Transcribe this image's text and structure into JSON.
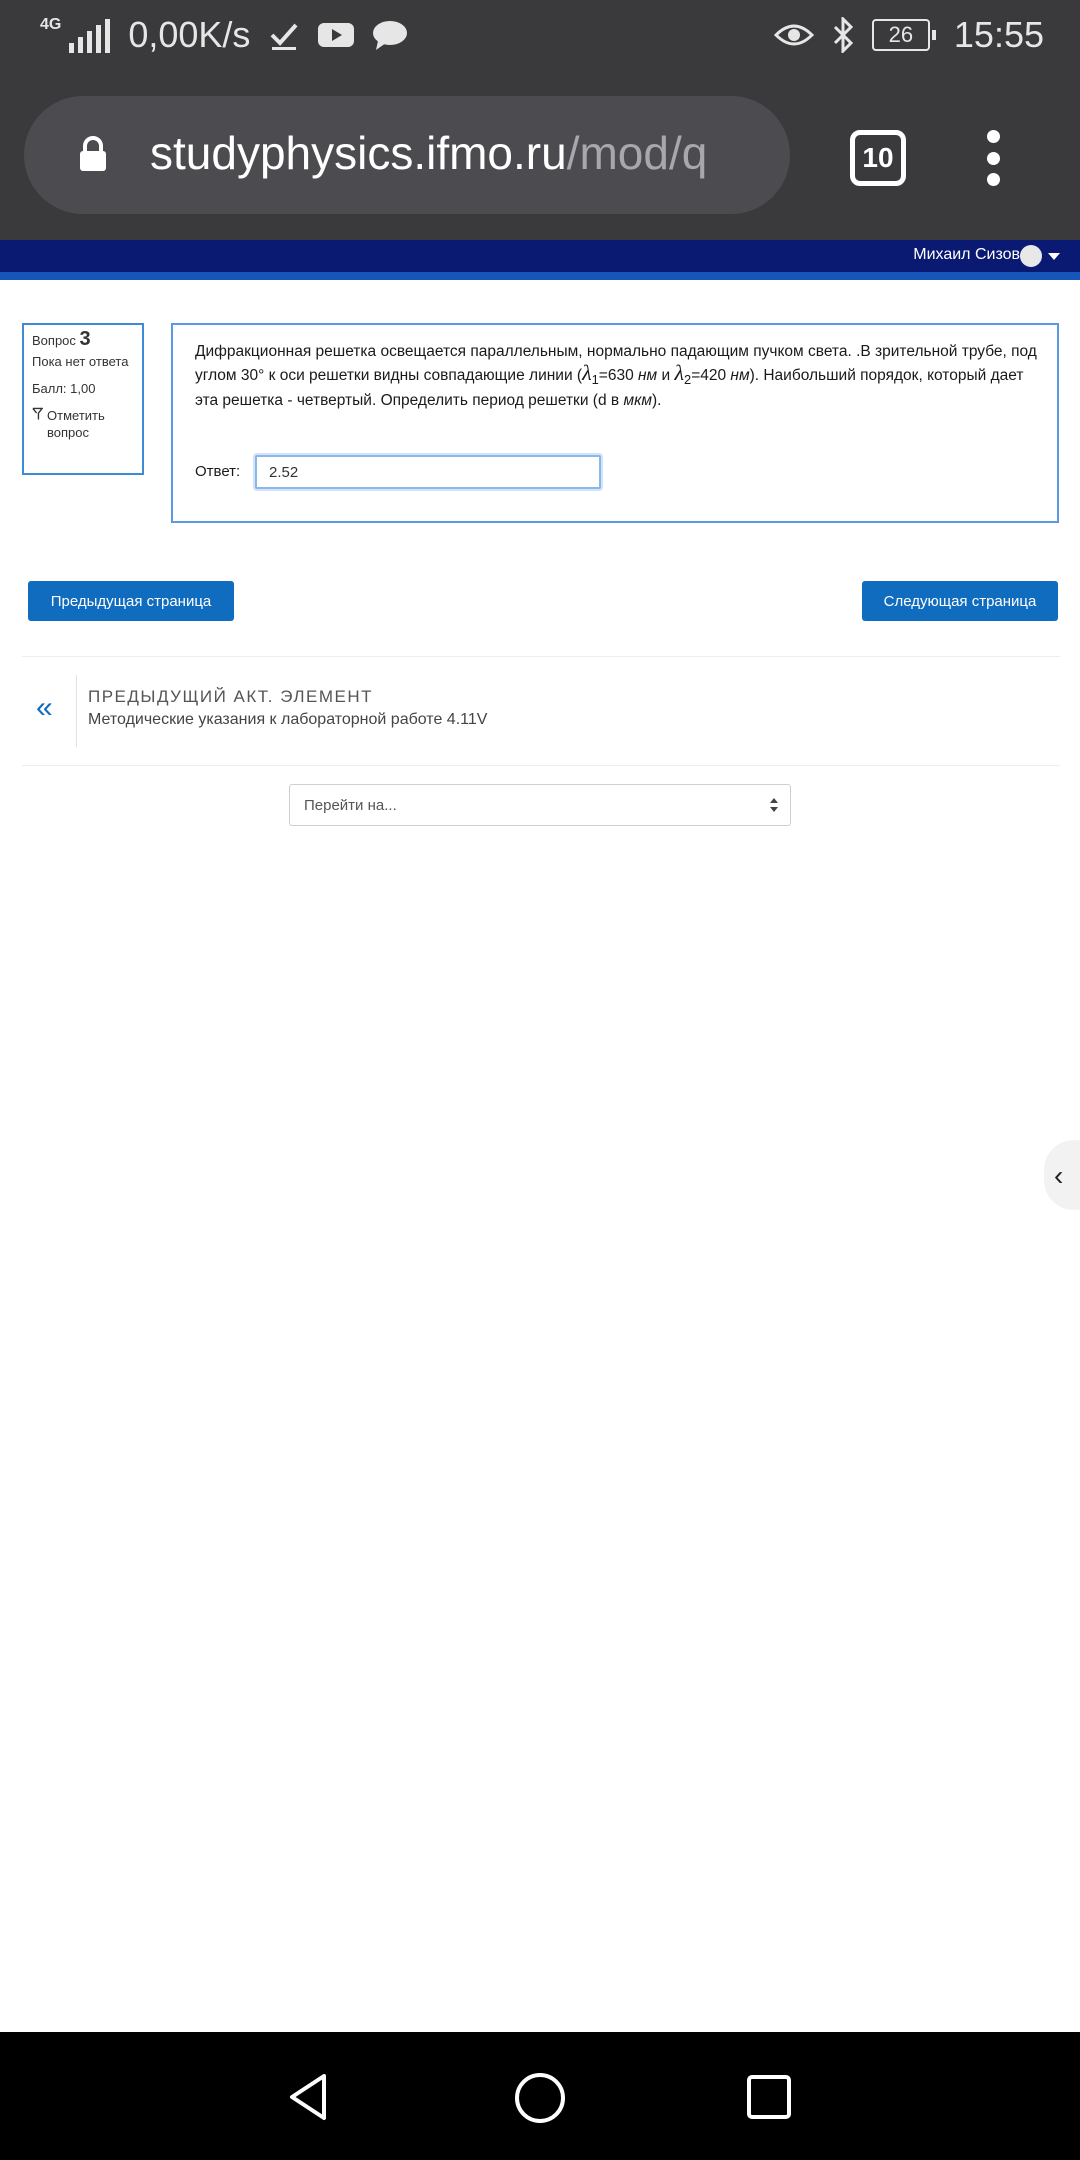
{
  "status_bar": {
    "network": "4G",
    "speed": "0,00K/s",
    "battery": "26",
    "time": "15:55"
  },
  "browser": {
    "url_domain": "studyphysics.ifmo.ru",
    "url_path": "/mod/q",
    "tab_count": "10"
  },
  "site_header": {
    "user_name": "Михаил Сизов"
  },
  "question_info": {
    "label": "Вопрос",
    "number": "3",
    "status": "Пока нет ответа",
    "score": "Балл: 1,00",
    "flag_label": "Отметить вопрос"
  },
  "question": {
    "text_part1": "Дифракционная решетка освещается параллельным, нормально падающим пучком света. .В зрительной трубе, под углом 30° к оси решетки видны совпадающие линии (",
    "lambda1": "λ",
    "sub1": "1",
    "val1": "=630 ",
    "unit1": "нм",
    "and": " и ",
    "lambda2": "λ",
    "sub2": "2",
    "val2": "=420 ",
    "unit2": "нм",
    "text_part2": "). Наибольший порядок, который  дает эта решетка     - четвертый. Определить период решетки (d в ",
    "unit3": "мкм",
    "text_part3": ").",
    "answer_label": "Ответ:",
    "answer_value": "2.52"
  },
  "navigation": {
    "prev_button": "Предыдущая страница",
    "next_button": "Следующая страница"
  },
  "previous_activity": {
    "chevron": "«",
    "label": "ПРЕДЫДУЩИЙ АКТ. ЭЛЕМЕНТ",
    "title": "Методические указания к лабораторной работе 4.11V"
  },
  "jump_to": {
    "placeholder": "Перейти на..."
  },
  "drawer": {
    "chevron": "‹"
  }
}
